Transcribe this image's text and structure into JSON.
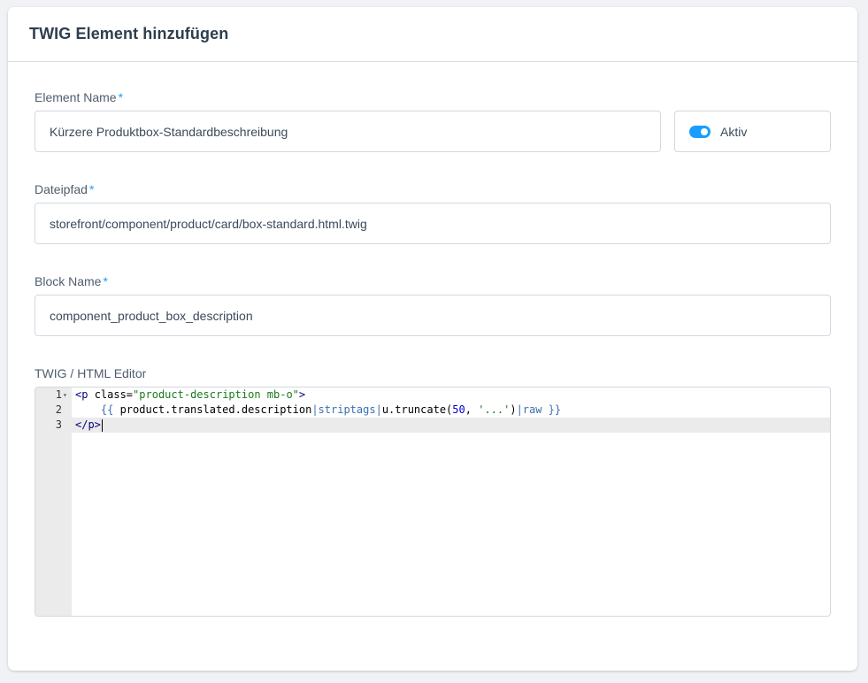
{
  "card": {
    "title": "TWIG Element hinzufügen"
  },
  "form": {
    "element_name": {
      "label": "Element Name",
      "required": "*",
      "value": "Kürzere Produktbox-Standardbeschreibung"
    },
    "active_toggle": {
      "label": "Aktiv",
      "checked": true
    },
    "file_path": {
      "label": "Dateipfad",
      "required": "*",
      "value": "storefront/component/product/card/box-standard.html.twig"
    },
    "block_name": {
      "label": "Block Name",
      "required": "*",
      "value": "component_product_box_description"
    },
    "editor": {
      "label": "TWIG / HTML Editor",
      "lines": [
        {
          "number": "1",
          "text": "<p class=\"product-description mb-o\">"
        },
        {
          "number": "2",
          "text": "    {{ product.translated.description|striptags|u.truncate(50, '...')|raw }}"
        },
        {
          "number": "3",
          "text": "</p>"
        }
      ]
    }
  },
  "colors": {
    "accent": "#189eff",
    "border": "#d1d9e0",
    "gutter": "#ebebeb"
  },
  "icons": {
    "fold": "fold-arrow-icon"
  }
}
